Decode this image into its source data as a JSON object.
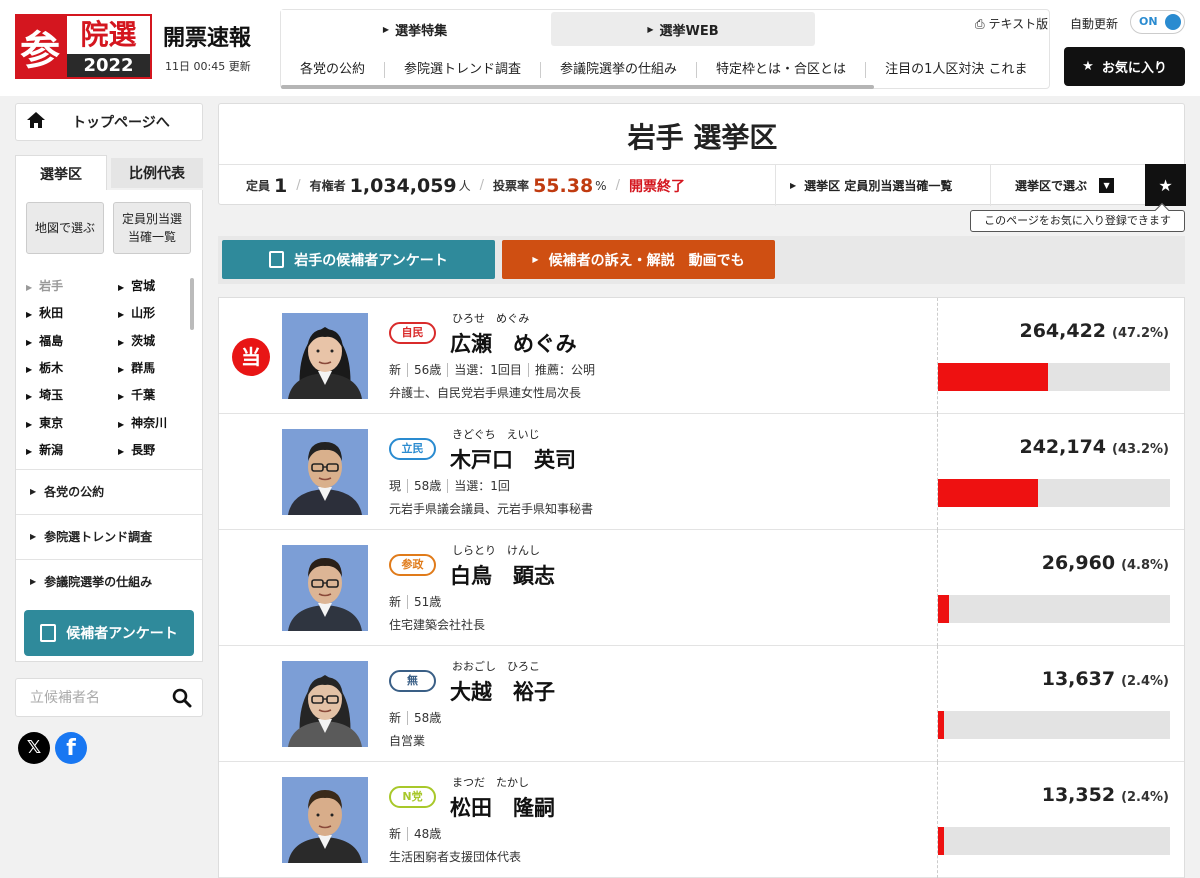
{
  "header": {
    "logo_kanji": "参",
    "logo_title": "院選",
    "logo_year": "2022",
    "brand": "開票速報",
    "updated": "11日 00:45 更新",
    "text_version": "テキスト版",
    "auto_update": "自動更新",
    "toggle_state": "ON",
    "favorite_label": "お気に入り"
  },
  "topnav": {
    "tabs": [
      {
        "label": "選挙特集"
      },
      {
        "label": "選挙WEB"
      }
    ],
    "links": [
      "各党の公約",
      "参院選トレンド調査",
      "参議院選挙の仕組み",
      "特定枠とは・合区とは",
      "注目の1人区対決 これま"
    ]
  },
  "sidebar": {
    "home_label": "トップページへ",
    "tabs": [
      "選挙区",
      "比例代表"
    ],
    "map_button": "地図で選ぶ",
    "list_button_line1": "定員別当選",
    "list_button_line2": "当確一覧",
    "prefectures": [
      "岩手",
      "宮城",
      "秋田",
      "山形",
      "福島",
      "茨城",
      "栃木",
      "群馬",
      "埼玉",
      "千葉",
      "東京",
      "神奈川",
      "新潟",
      "長野"
    ],
    "links": [
      "各党の公約",
      "参院選トレンド調査",
      "参議院選挙の仕組み"
    ],
    "survey_button": "候補者アンケート",
    "search_placeholder": "立候補者名"
  },
  "district": {
    "title": "岩手 選挙区",
    "seats_label": "定員",
    "seats": "1",
    "voters_label": "有権者",
    "voters": "1,034,059",
    "voters_unit": "人",
    "turnout_label": "投票率",
    "turnout": "55.38",
    "turnout_unit": "%",
    "status": "開票終了",
    "winner_list_link": "選挙区 定員別当選当確一覧",
    "select_district": "選挙区で選ぶ",
    "fav_tooltip": "このページをお気に入り登録できます"
  },
  "actions": {
    "survey": "岩手の候補者アンケート",
    "video": "候補者の訴え・解説　動画でも"
  },
  "colors": {
    "red": "#d4161f",
    "teal": "#2f8a9b",
    "orange": "#cf4f12",
    "bar_fill": "#ee1111"
  },
  "candidates": [
    {
      "winner": true,
      "win_mark": "当",
      "party": "自民",
      "party_color": "#d92b2b",
      "kana": "ひろせ　めぐみ",
      "name": "広瀬　めぐみ",
      "meta": [
        "新",
        "56歳",
        "当選：1回目",
        "推薦：公明"
      ],
      "job": "弁護士、自民党岩手県連女性局次長",
      "votes": "264,422",
      "pct": "(47.2%)",
      "share": 0.472
    },
    {
      "winner": false,
      "win_mark": "",
      "party": "立民",
      "party_color": "#2a8bd0",
      "kana": "きどぐち　えいじ",
      "name": "木戸口　英司",
      "meta": [
        "現",
        "58歳",
        "当選：1回"
      ],
      "job": "元岩手県議会議員、元岩手県知事秘書",
      "votes": "242,174",
      "pct": "(43.2%)",
      "share": 0.432
    },
    {
      "winner": false,
      "win_mark": "",
      "party": "参政",
      "party_color": "#e07b1a",
      "kana": "しらとり　けんし",
      "name": "白鳥　顕志",
      "meta": [
        "新",
        "51歳"
      ],
      "job": "住宅建築会社社長",
      "votes": "26,960",
      "pct": "(4.8%)",
      "share": 0.048
    },
    {
      "winner": false,
      "win_mark": "",
      "party": "無",
      "party_color": "#3a5f86",
      "kana": "おおごし　ひろこ",
      "name": "大越　裕子",
      "meta": [
        "新",
        "58歳"
      ],
      "job": "自営業",
      "votes": "13,637",
      "pct": "(2.4%)",
      "share": 0.024
    },
    {
      "winner": false,
      "win_mark": "",
      "party": "N党",
      "party_color": "#a8c82a",
      "kana": "まつだ　たかし",
      "name": "松田　隆嗣",
      "meta": [
        "新",
        "48歳"
      ],
      "job": "生活困窮者支援団体代表",
      "votes": "13,352",
      "pct": "(2.4%)",
      "share": 0.024
    }
  ]
}
